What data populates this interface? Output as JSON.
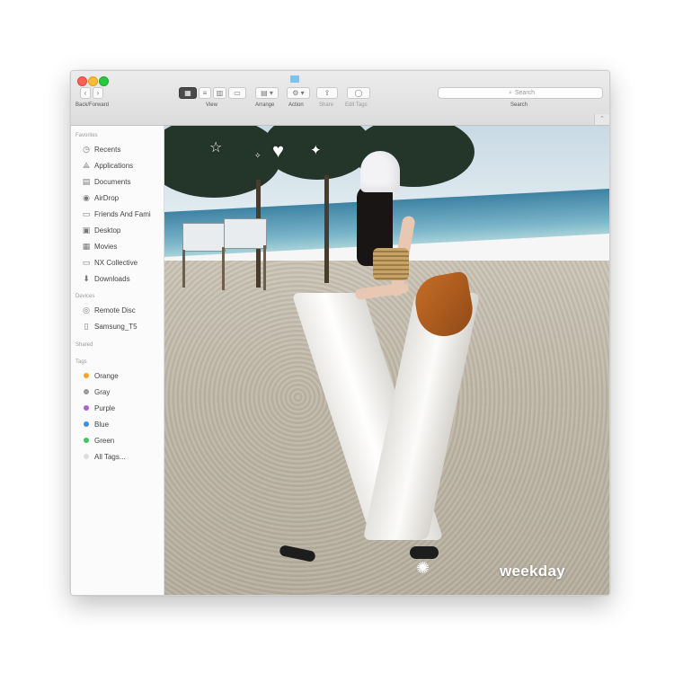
{
  "toolbar": {
    "back_forward_label": "Back/Forward",
    "view_label": "View",
    "arrange_label": "Arrange",
    "action_label": "Action",
    "share_label": "Share",
    "edit_tags_label": "Edit Tags",
    "search_label": "Search",
    "search_placeholder": "Search"
  },
  "sidebar": {
    "favorites_title": "Favorites",
    "favorites": [
      {
        "label": "Recents",
        "icon": "clock-icon"
      },
      {
        "label": "Applications",
        "icon": "applications-icon"
      },
      {
        "label": "Documents",
        "icon": "document-icon"
      },
      {
        "label": "AirDrop",
        "icon": "airdrop-icon"
      },
      {
        "label": "Friends And Fami",
        "icon": "folder-icon"
      },
      {
        "label": "Desktop",
        "icon": "desktop-icon"
      },
      {
        "label": "Movies",
        "icon": "film-icon"
      },
      {
        "label": "NX Collective",
        "icon": "folder-icon"
      },
      {
        "label": "Downloads",
        "icon": "download-icon"
      }
    ],
    "devices_title": "Devices",
    "devices": [
      {
        "label": "Remote Disc",
        "icon": "disc-icon"
      },
      {
        "label": "Samsung_T5",
        "icon": "drive-icon"
      }
    ],
    "shared_title": "Shared",
    "tags_title": "Tags",
    "tags": [
      {
        "label": "Orange",
        "color": "#f5a623"
      },
      {
        "label": "Gray",
        "color": "#9b9b9b"
      },
      {
        "label": "Purple",
        "color": "#b05ed6"
      },
      {
        "label": "Blue",
        "color": "#3b8fe6"
      },
      {
        "label": "Green",
        "color": "#43c463"
      },
      {
        "label": "All Tags...",
        "color": "#dddddd"
      }
    ]
  },
  "content": {
    "watermark": "weekday"
  }
}
